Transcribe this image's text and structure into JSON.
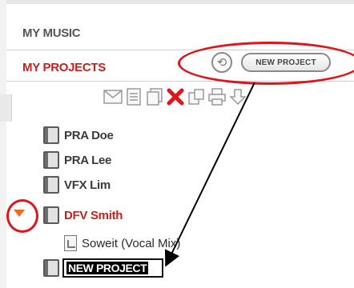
{
  "panel": {
    "my_music": "MY MUSIC",
    "my_projects": "MY PROJECTS",
    "new_project_button": "NEW PROJECT",
    "refresh_glyph": "⟲"
  },
  "toolbar": {
    "icons": [
      "email-icon",
      "document-icon",
      "copy-icon",
      "delete-icon",
      "share-icon",
      "print-icon",
      "download-icon"
    ],
    "delete_color": "#e0141a"
  },
  "tree": {
    "items": [
      {
        "label": "PRA Doe",
        "color": "#3a3a3a"
      },
      {
        "label": "PRA Lee",
        "color": "#3a3a3a"
      },
      {
        "label": "VFX Lim",
        "color": "#3a3a3a"
      },
      {
        "label": "DFV Smith",
        "color": "#c8201c",
        "expanded": true
      }
    ],
    "file": "Soweit (Vocal Mix)",
    "new_item_value": "NEW PROJECT"
  },
  "annotation_color": "#e0141a"
}
